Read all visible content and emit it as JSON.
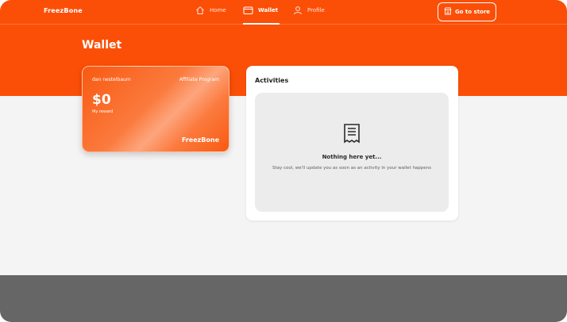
{
  "brand": {
    "logo_text": "FreezBone",
    "accent_color": "#fb4f07"
  },
  "nav": {
    "items": [
      {
        "label": "Home",
        "icon": "home-icon",
        "active": false
      },
      {
        "label": "Wallet",
        "icon": "wallet-icon",
        "active": true
      },
      {
        "label": "Profile",
        "icon": "user-icon",
        "active": false
      }
    ],
    "store_button": {
      "label": "Go to store",
      "icon": "store-icon"
    }
  },
  "page": {
    "title": "Wallet"
  },
  "reward_card": {
    "user_name": "dan nestelbaum",
    "program": "Affiliate Program",
    "amount": "$0",
    "caption": "My reward",
    "logo_text": "FreezBone"
  },
  "activities": {
    "title": "Activities",
    "empty_icon": "receipt-icon",
    "empty_title": "Nothing here yet...",
    "empty_text": "Stay cool, we'll update you as soon as an activity in your wallet happens"
  }
}
